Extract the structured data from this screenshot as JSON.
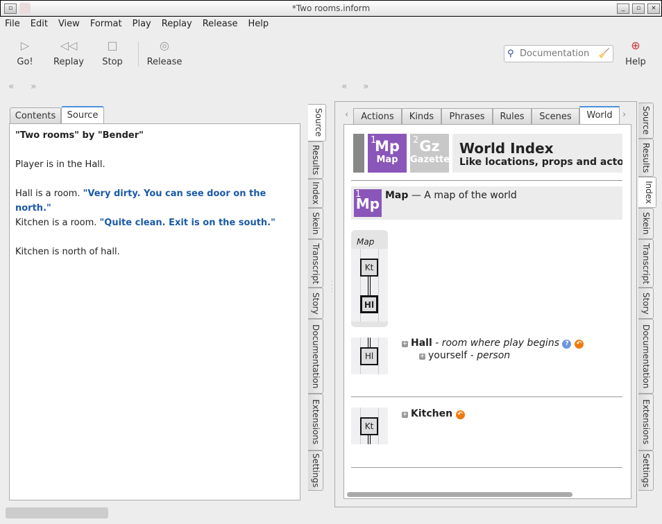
{
  "window": {
    "title": "*Two rooms.inform"
  },
  "menu": [
    "File",
    "Edit",
    "View",
    "Format",
    "Play",
    "Replay",
    "Release",
    "Help"
  ],
  "toolbar": {
    "go": "Go!",
    "replay": "Replay",
    "stop": "Stop",
    "release": "Release",
    "search_placeholder": "Documentation",
    "help": "Help"
  },
  "left": {
    "tabs": [
      "Contents",
      "Source"
    ],
    "source": {
      "l1": "\"Two rooms\" by \"Bender\"",
      "l2": "Player is in the Hall.",
      "l3a": "Hall is a room. ",
      "l3b": "\"Very dirty. You can see door on the north.\"",
      "l4a": "Kitchen is a room. ",
      "l4b": "\"Quite clean. Exit is on the south.\"",
      "l5": "Kitchen is north of hall."
    }
  },
  "side_tabs": [
    "Source",
    "Results",
    "Index",
    "Skein",
    "Transcript",
    "Story",
    "Documentation",
    "Extensions",
    "Settings"
  ],
  "right": {
    "tabs": [
      "Actions",
      "Kinds",
      "Phrases",
      "Rules",
      "Scenes",
      "World"
    ],
    "header": {
      "n1": "1",
      "abbr1": "Mp",
      "label1": "Map",
      "n2": "2",
      "abbr2": "Gz",
      "label2": "Gazetteer",
      "title": "World Index",
      "subtitle": "Like locations, props and actors"
    },
    "map_row": {
      "n": "1",
      "abbr": "Mp",
      "title": "Map",
      "desc": " — A map of the world"
    },
    "map": {
      "label": "Map",
      "kt": "Kt",
      "hl": "Hl"
    },
    "hall": {
      "name": "Hall",
      "desc": " - room where play begins",
      "child": "yourself",
      "child_kind": " - person"
    },
    "kitchen": {
      "name": "Kitchen"
    }
  },
  "colors": {
    "accent": "#8a56ba",
    "link": "#1a5aa8"
  }
}
